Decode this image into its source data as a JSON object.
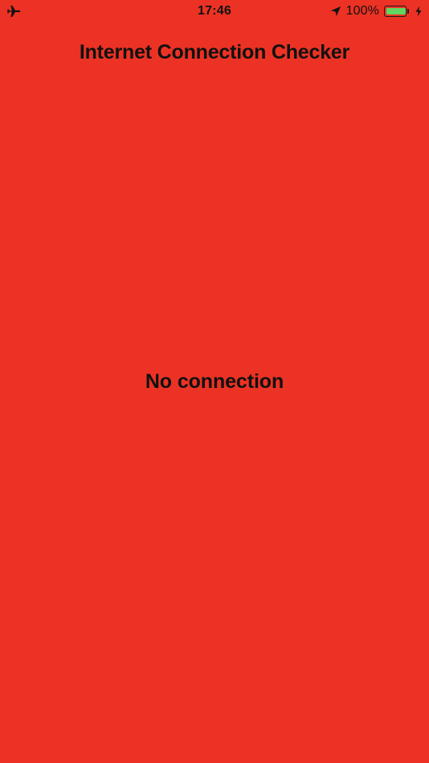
{
  "theme": {
    "background_color": "#ec3224",
    "text_color": "#111111",
    "battery_fill_color": "#62d660"
  },
  "status_bar": {
    "left_icon": "airplane-mode-icon",
    "time": "17:46",
    "location_icon": "location-arrow-icon",
    "battery_percent": "100%",
    "battery_level_percent": 100,
    "battery_icon": "battery-icon",
    "charging_icon": "charging-bolt-icon"
  },
  "header": {
    "title": "Internet Connection Checker"
  },
  "main": {
    "status_message": "No connection"
  }
}
